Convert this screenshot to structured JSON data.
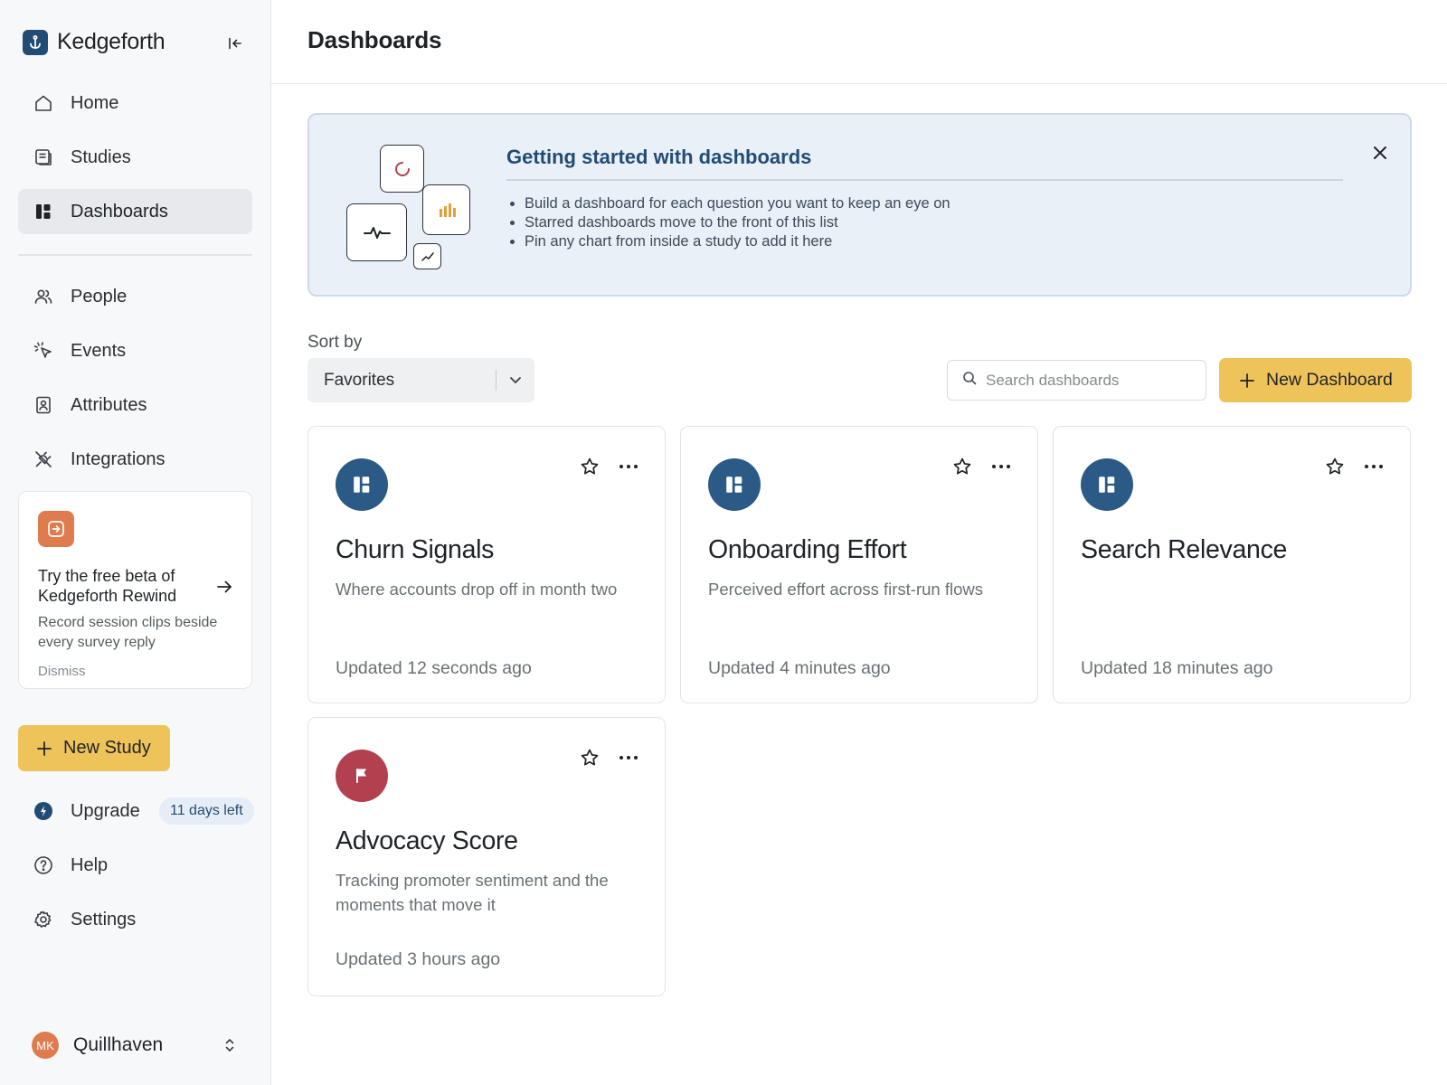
{
  "app": {
    "name": "Kedgeforth"
  },
  "sidebar": {
    "collapse_icon": "collapse-left-icon",
    "nav_primary": [
      {
        "label": "Home",
        "icon": "home-icon",
        "active": false
      },
      {
        "label": "Studies",
        "icon": "studies-icon",
        "active": false
      },
      {
        "label": "Dashboards",
        "icon": "dashboards-icon",
        "active": true
      }
    ],
    "nav_secondary": [
      {
        "label": "People",
        "icon": "people-icon"
      },
      {
        "label": "Events",
        "icon": "cursor-click-icon"
      },
      {
        "label": "Attributes",
        "icon": "id-badge-icon"
      },
      {
        "label": "Integrations",
        "icon": "plug-icon"
      }
    ],
    "promo": {
      "title": "Try the free beta of Kedgeforth Rewind",
      "description": "Record session clips beside every survey reply",
      "dismiss": "Dismiss"
    },
    "new_study_label": "New Study",
    "upgrade": {
      "label": "Upgrade",
      "badge": "11 days left"
    },
    "help_label": "Help",
    "settings_label": "Settings",
    "user": {
      "initials": "MK",
      "workspace": "Quillhaven"
    }
  },
  "main": {
    "title": "Dashboards",
    "banner": {
      "title": "Getting started with dashboards",
      "bullets": [
        "Build a dashboard for each question you want to keep an eye on",
        "Starred dashboards move to the front of this list",
        "Pin any chart from inside a study to add it here"
      ]
    },
    "sort": {
      "label": "Sort by",
      "value": "Favorites"
    },
    "search": {
      "placeholder": "Search dashboards",
      "value": ""
    },
    "new_dashboard_label": "New Dashboard",
    "cards": [
      {
        "title": "Churn Signals",
        "description": "Where accounts drop off in month two",
        "updated": "Updated 12 seconds ago",
        "icon": "dashboard-icon",
        "color": "#2a5a85"
      },
      {
        "title": "Onboarding Effort",
        "description": "Perceived effort across first-run flows",
        "updated": "Updated 4 minutes ago",
        "icon": "dashboard-icon",
        "color": "#2a5a85"
      },
      {
        "title": "Search Relevance",
        "description": "",
        "updated": "Updated 18 minutes ago",
        "icon": "dashboard-icon",
        "color": "#2a5a85"
      },
      {
        "title": "Advocacy Score",
        "description": "Tracking promoter sentiment and the moments that move it",
        "updated": "Updated 3 hours ago",
        "icon": "flag-icon",
        "color": "#b2404f"
      }
    ]
  },
  "colors": {
    "accent": "#eec35a",
    "brand": "#214c74",
    "promo": "#df7b4f"
  }
}
